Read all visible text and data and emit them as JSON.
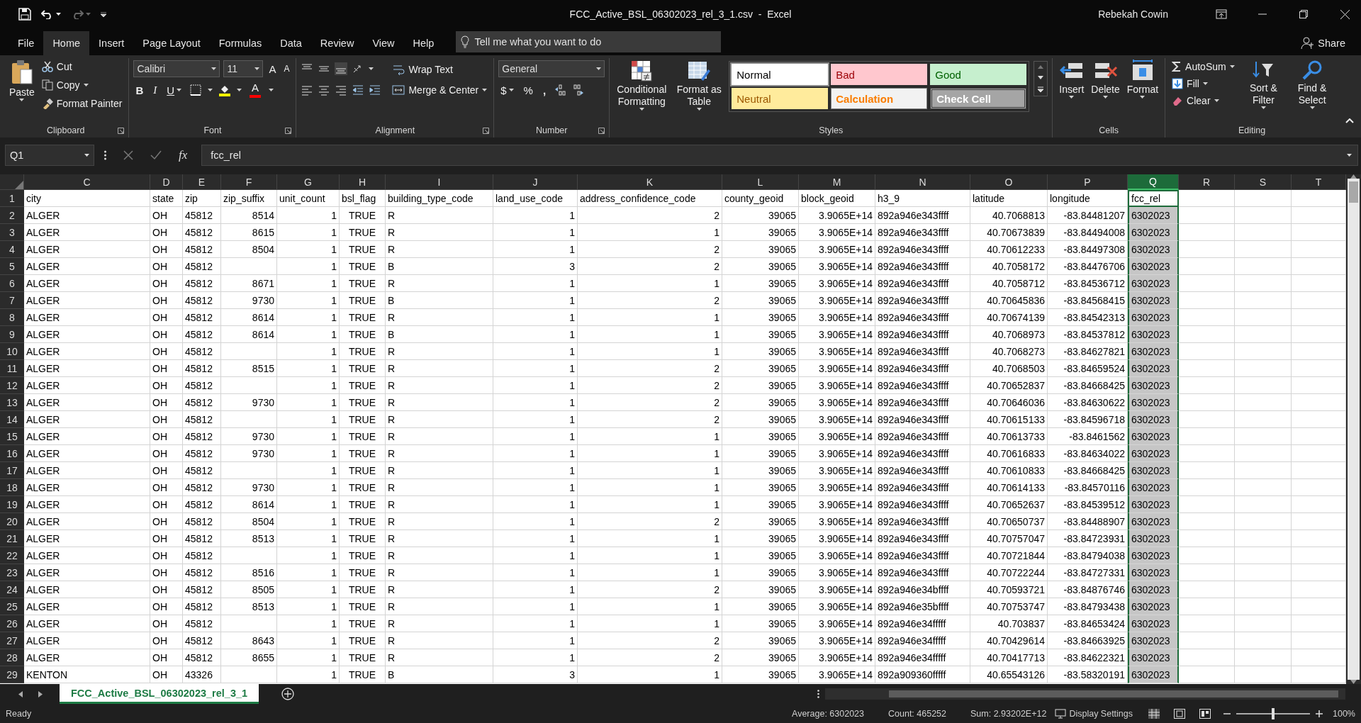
{
  "title_bar": {
    "title": "FCC_Active_BSL_06302023_rel_3_1.csv  -  Excel",
    "user": "Rebekah Cowin"
  },
  "ribbon_tabs": [
    {
      "label": "File",
      "selected": false
    },
    {
      "label": "Home",
      "selected": true
    },
    {
      "label": "Insert",
      "selected": false
    },
    {
      "label": "Page Layout",
      "selected": false
    },
    {
      "label": "Formulas",
      "selected": false
    },
    {
      "label": "Data",
      "selected": false
    },
    {
      "label": "Review",
      "selected": false
    },
    {
      "label": "View",
      "selected": false
    },
    {
      "label": "Help",
      "selected": false
    }
  ],
  "tell_me": {
    "placeholder": "Tell me what you want to do"
  },
  "share": "Share",
  "ribbon": {
    "clipboard": {
      "label": "Clipboard",
      "paste": "Paste",
      "cut": "Cut",
      "copy": "Copy",
      "format_painter": "Format Painter"
    },
    "font": {
      "label": "Font",
      "family": "Calibri",
      "size": "11",
      "grow": "A",
      "shrink": "A",
      "bold": "B",
      "italic": "I",
      "underline": "U",
      "font_color": "A"
    },
    "alignment": {
      "label": "Alignment",
      "wrap_text": "Wrap Text",
      "merge_center": "Merge & Center"
    },
    "number": {
      "label": "Number",
      "format": "General",
      "currency": "$",
      "percent": "%",
      "comma": ","
    },
    "styles": {
      "label": "Styles",
      "conditional_formatting": "Conditional Formatting",
      "format_as_table": "Format as Table",
      "gallery": [
        {
          "label": "Normal",
          "kind": "normal",
          "selected": true
        },
        {
          "label": "Bad",
          "kind": "bad",
          "selected": false
        },
        {
          "label": "Good",
          "kind": "good",
          "selected": false
        },
        {
          "label": "Neutral",
          "kind": "neutral",
          "selected": false
        },
        {
          "label": "Calculation",
          "kind": "calculation",
          "selected": false
        },
        {
          "label": "Check Cell",
          "kind": "check",
          "selected": false
        }
      ]
    },
    "cells": {
      "label": "Cells",
      "insert": "Insert",
      "delete": "Delete",
      "format": "Format"
    },
    "editing": {
      "label": "Editing",
      "autosum": "AutoSum",
      "fill": "Fill",
      "clear": "Clear",
      "sort_filter": "Sort & Filter",
      "find_select": "Find & Select"
    }
  },
  "formula_bar": {
    "name_box": "Q1",
    "fx": "fx",
    "value": "fcc_rel"
  },
  "sheet": {
    "columns": [
      {
        "label": "C",
        "selected": false
      },
      {
        "label": "D",
        "selected": false
      },
      {
        "label": "E",
        "selected": false
      },
      {
        "label": "F",
        "selected": false
      },
      {
        "label": "G",
        "selected": false
      },
      {
        "label": "H",
        "selected": false
      },
      {
        "label": "I",
        "selected": false
      },
      {
        "label": "J",
        "selected": false
      },
      {
        "label": "K",
        "selected": false
      },
      {
        "label": "L",
        "selected": false
      },
      {
        "label": "M",
        "selected": false
      },
      {
        "label": "N",
        "selected": false
      },
      {
        "label": "O",
        "selected": false
      },
      {
        "label": "P",
        "selected": false
      },
      {
        "label": "Q",
        "selected": true
      },
      {
        "label": "R",
        "selected": false
      },
      {
        "label": "S",
        "selected": false
      },
      {
        "label": "T",
        "selected": false
      }
    ],
    "rows": [
      {
        "num": "1",
        "cells": [
          "city",
          "state",
          "zip",
          "zip_suffix",
          "unit_count",
          "bsl_flag",
          "building_type_code",
          "land_use_code",
          "address_confidence_code",
          "county_geoid",
          "block_geoid",
          "h3_9",
          "latitude",
          "longitude",
          "fcc_rel"
        ]
      },
      {
        "num": "2",
        "cells": [
          "ALGER",
          "OH",
          "45812",
          "8514",
          "1",
          "TRUE",
          "R",
          "1",
          "2",
          "39065",
          "3.9065E+14",
          "892a946e343ffff",
          "40.7068813",
          "-83.84481207",
          "6302023"
        ]
      },
      {
        "num": "3",
        "cells": [
          "ALGER",
          "OH",
          "45812",
          "8615",
          "1",
          "TRUE",
          "R",
          "1",
          "1",
          "39065",
          "3.9065E+14",
          "892a946e343ffff",
          "40.70673839",
          "-83.84494008",
          "6302023"
        ]
      },
      {
        "num": "4",
        "cells": [
          "ALGER",
          "OH",
          "45812",
          "8504",
          "1",
          "TRUE",
          "R",
          "1",
          "2",
          "39065",
          "3.9065E+14",
          "892a946e343ffff",
          "40.70612233",
          "-83.84497308",
          "6302023"
        ]
      },
      {
        "num": "5",
        "cells": [
          "ALGER",
          "OH",
          "45812",
          null,
          "1",
          "TRUE",
          "B",
          "3",
          "2",
          "39065",
          "3.9065E+14",
          "892a946e343ffff",
          "40.7058172",
          "-83.84476706",
          "6302023"
        ]
      },
      {
        "num": "6",
        "cells": [
          "ALGER",
          "OH",
          "45812",
          "8671",
          "1",
          "TRUE",
          "R",
          "1",
          "1",
          "39065",
          "3.9065E+14",
          "892a946e343ffff",
          "40.7058712",
          "-83.84536712",
          "6302023"
        ]
      },
      {
        "num": "7",
        "cells": [
          "ALGER",
          "OH",
          "45812",
          "9730",
          "1",
          "TRUE",
          "B",
          "1",
          "2",
          "39065",
          "3.9065E+14",
          "892a946e343ffff",
          "40.70645836",
          "-83.84568415",
          "6302023"
        ]
      },
      {
        "num": "8",
        "cells": [
          "ALGER",
          "OH",
          "45812",
          "8614",
          "1",
          "TRUE",
          "R",
          "1",
          "1",
          "39065",
          "3.9065E+14",
          "892a946e343ffff",
          "40.70674139",
          "-83.84542313",
          "6302023"
        ]
      },
      {
        "num": "9",
        "cells": [
          "ALGER",
          "OH",
          "45812",
          "8614",
          "1",
          "TRUE",
          "B",
          "1",
          "1",
          "39065",
          "3.9065E+14",
          "892a946e343ffff",
          "40.7068973",
          "-83.84537812",
          "6302023"
        ]
      },
      {
        "num": "10",
        "cells": [
          "ALGER",
          "OH",
          "45812",
          null,
          "1",
          "TRUE",
          "R",
          "1",
          "1",
          "39065",
          "3.9065E+14",
          "892a946e343ffff",
          "40.7068273",
          "-83.84627821",
          "6302023"
        ]
      },
      {
        "num": "11",
        "cells": [
          "ALGER",
          "OH",
          "45812",
          "8515",
          "1",
          "TRUE",
          "R",
          "1",
          "2",
          "39065",
          "3.9065E+14",
          "892a946e343ffff",
          "40.7068503",
          "-83.84659524",
          "6302023"
        ]
      },
      {
        "num": "12",
        "cells": [
          "ALGER",
          "OH",
          "45812",
          null,
          "1",
          "TRUE",
          "R",
          "1",
          "2",
          "39065",
          "3.9065E+14",
          "892a946e343ffff",
          "40.70652837",
          "-83.84668425",
          "6302023"
        ]
      },
      {
        "num": "13",
        "cells": [
          "ALGER",
          "OH",
          "45812",
          "9730",
          "1",
          "TRUE",
          "R",
          "1",
          "2",
          "39065",
          "3.9065E+14",
          "892a946e343ffff",
          "40.70646036",
          "-83.84630622",
          "6302023"
        ]
      },
      {
        "num": "14",
        "cells": [
          "ALGER",
          "OH",
          "45812",
          null,
          "1",
          "TRUE",
          "R",
          "1",
          "2",
          "39065",
          "3.9065E+14",
          "892a946e343ffff",
          "40.70615133",
          "-83.84596718",
          "6302023"
        ]
      },
      {
        "num": "15",
        "cells": [
          "ALGER",
          "OH",
          "45812",
          "9730",
          "1",
          "TRUE",
          "R",
          "1",
          "1",
          "39065",
          "3.9065E+14",
          "892a946e343ffff",
          "40.70613733",
          "-83.8461562",
          "6302023"
        ]
      },
      {
        "num": "16",
        "cells": [
          "ALGER",
          "OH",
          "45812",
          "9730",
          "1",
          "TRUE",
          "R",
          "1",
          "1",
          "39065",
          "3.9065E+14",
          "892a946e343ffff",
          "40.70616833",
          "-83.84634022",
          "6302023"
        ]
      },
      {
        "num": "17",
        "cells": [
          "ALGER",
          "OH",
          "45812",
          null,
          "1",
          "TRUE",
          "R",
          "1",
          "1",
          "39065",
          "3.9065E+14",
          "892a946e343ffff",
          "40.70610833",
          "-83.84668425",
          "6302023"
        ]
      },
      {
        "num": "18",
        "cells": [
          "ALGER",
          "OH",
          "45812",
          "9730",
          "1",
          "TRUE",
          "R",
          "1",
          "1",
          "39065",
          "3.9065E+14",
          "892a946e343ffff",
          "40.70614133",
          "-83.84570116",
          "6302023"
        ]
      },
      {
        "num": "19",
        "cells": [
          "ALGER",
          "OH",
          "45812",
          "8614",
          "1",
          "TRUE",
          "R",
          "1",
          "1",
          "39065",
          "3.9065E+14",
          "892a946e343ffff",
          "40.70652637",
          "-83.84539512",
          "6302023"
        ]
      },
      {
        "num": "20",
        "cells": [
          "ALGER",
          "OH",
          "45812",
          "8504",
          "1",
          "TRUE",
          "R",
          "1",
          "2",
          "39065",
          "3.9065E+14",
          "892a946e343ffff",
          "40.70650737",
          "-83.84488907",
          "6302023"
        ]
      },
      {
        "num": "21",
        "cells": [
          "ALGER",
          "OH",
          "45812",
          "8513",
          "1",
          "TRUE",
          "R",
          "1",
          "1",
          "39065",
          "3.9065E+14",
          "892a946e343ffff",
          "40.70757047",
          "-83.84723931",
          "6302023"
        ]
      },
      {
        "num": "22",
        "cells": [
          "ALGER",
          "OH",
          "45812",
          null,
          "1",
          "TRUE",
          "R",
          "1",
          "1",
          "39065",
          "3.9065E+14",
          "892a946e343ffff",
          "40.70721844",
          "-83.84794038",
          "6302023"
        ]
      },
      {
        "num": "23",
        "cells": [
          "ALGER",
          "OH",
          "45812",
          "8516",
          "1",
          "TRUE",
          "R",
          "1",
          "1",
          "39065",
          "3.9065E+14",
          "892a946e343ffff",
          "40.70722244",
          "-83.84727331",
          "6302023"
        ]
      },
      {
        "num": "24",
        "cells": [
          "ALGER",
          "OH",
          "45812",
          "8505",
          "1",
          "TRUE",
          "R",
          "1",
          "2",
          "39065",
          "3.9065E+14",
          "892a946e34bffff",
          "40.70593721",
          "-83.84876746",
          "6302023"
        ]
      },
      {
        "num": "25",
        "cells": [
          "ALGER",
          "OH",
          "45812",
          "8513",
          "1",
          "TRUE",
          "R",
          "1",
          "1",
          "39065",
          "3.9065E+14",
          "892a946e35bffff",
          "40.70753747",
          "-83.84793438",
          "6302023"
        ]
      },
      {
        "num": "26",
        "cells": [
          "ALGER",
          "OH",
          "45812",
          null,
          "1",
          "TRUE",
          "R",
          "1",
          "1",
          "39065",
          "3.9065E+14",
          "892a946e34fffff",
          "40.703837",
          "-83.84653424",
          "6302023"
        ]
      },
      {
        "num": "27",
        "cells": [
          "ALGER",
          "OH",
          "45812",
          "8643",
          "1",
          "TRUE",
          "R",
          "1",
          "2",
          "39065",
          "3.9065E+14",
          "892a946e34fffff",
          "40.70429614",
          "-83.84663925",
          "6302023"
        ]
      },
      {
        "num": "28",
        "cells": [
          "ALGER",
          "OH",
          "45812",
          "8655",
          "1",
          "TRUE",
          "R",
          "1",
          "2",
          "39065",
          "3.9065E+14",
          "892a946e34fffff",
          "40.70417713",
          "-83.84622321",
          "6302023"
        ]
      },
      {
        "num": "29",
        "cells": [
          "KENTON",
          "OH",
          "43326",
          null,
          "1",
          "TRUE",
          "B",
          "3",
          "1",
          "39065",
          "3.9065E+14",
          "892a909360fffff",
          "40.65543126",
          "-83.58320191",
          "6302023"
        ]
      }
    ]
  },
  "sheet_tabs": [
    {
      "label": "FCC_Active_BSL_06302023_rel_3_1",
      "selected": true
    }
  ],
  "status_bar": {
    "mode": "Ready",
    "average": "Average: 6302023",
    "count": "Count: 465252",
    "sum": "Sum: 2.93202E+12",
    "display_settings": "Display Settings",
    "zoom": "100%",
    "zoom_slider": {
      "level": 0.5
    }
  }
}
